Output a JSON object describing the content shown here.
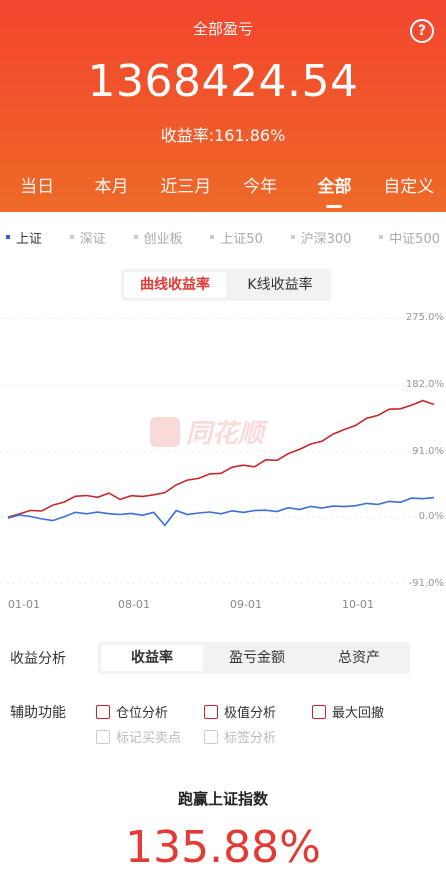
{
  "header": {
    "title": "全部盈亏",
    "help_icon": "question-circle-icon",
    "total": "1368424.54",
    "rate_label": "收益率:161.86%"
  },
  "period_tabs": [
    "当日",
    "本月",
    "近三月",
    "今年",
    "全部",
    "自定义"
  ],
  "period_active": "全部",
  "indices": [
    "上证",
    "深证",
    "创业板",
    "上证50",
    "沪深300",
    "中证500"
  ],
  "indices_active": "上证",
  "chart_toggle": [
    "曲线收益率",
    "K线收益率"
  ],
  "chart_toggle_active": "曲线收益率",
  "watermark": "同花顺",
  "chart_data": {
    "type": "line",
    "x_ticks": [
      "01-01",
      "08-01",
      "09-01",
      "10-01"
    ],
    "y_ticks": [
      "275.0%",
      "182.0%",
      "91.0%",
      "0.0%",
      "-91.0%"
    ],
    "ylim": [
      -91,
      275
    ],
    "series": [
      {
        "color": "#c62828",
        "values": [
          0,
          5,
          8,
          10,
          15,
          22,
          28,
          30,
          28,
          32,
          26,
          28,
          30,
          30,
          34,
          45,
          50,
          55,
          58,
          62,
          68,
          72,
          70,
          78,
          80,
          86,
          95,
          100,
          105,
          115,
          120,
          128,
          135,
          142,
          148,
          150,
          155,
          160,
          157
        ]
      },
      {
        "color": "#3b6fd8",
        "values": [
          0,
          2,
          1,
          -2,
          -6,
          2,
          5,
          6,
          6,
          5,
          4,
          4,
          4,
          5,
          -10,
          8,
          4,
          6,
          6,
          6,
          7,
          8,
          8,
          10,
          8,
          12,
          12,
          13,
          14,
          14,
          15,
          16,
          18,
          19,
          20,
          22,
          25,
          26,
          27
        ]
      }
    ]
  },
  "analysis_label": "收益分析",
  "analysis_options": [
    "收益率",
    "盈亏金额",
    "总资产"
  ],
  "analysis_active": "收益率",
  "aux_label": "辅助功能",
  "aux_options": [
    "仓位分析",
    "极值分析",
    "最大回撤"
  ],
  "aux_options_disabled": [
    "标记买卖点",
    "标签分析"
  ],
  "beat_title": "跑赢上证指数",
  "beat_value": "135.88%"
}
